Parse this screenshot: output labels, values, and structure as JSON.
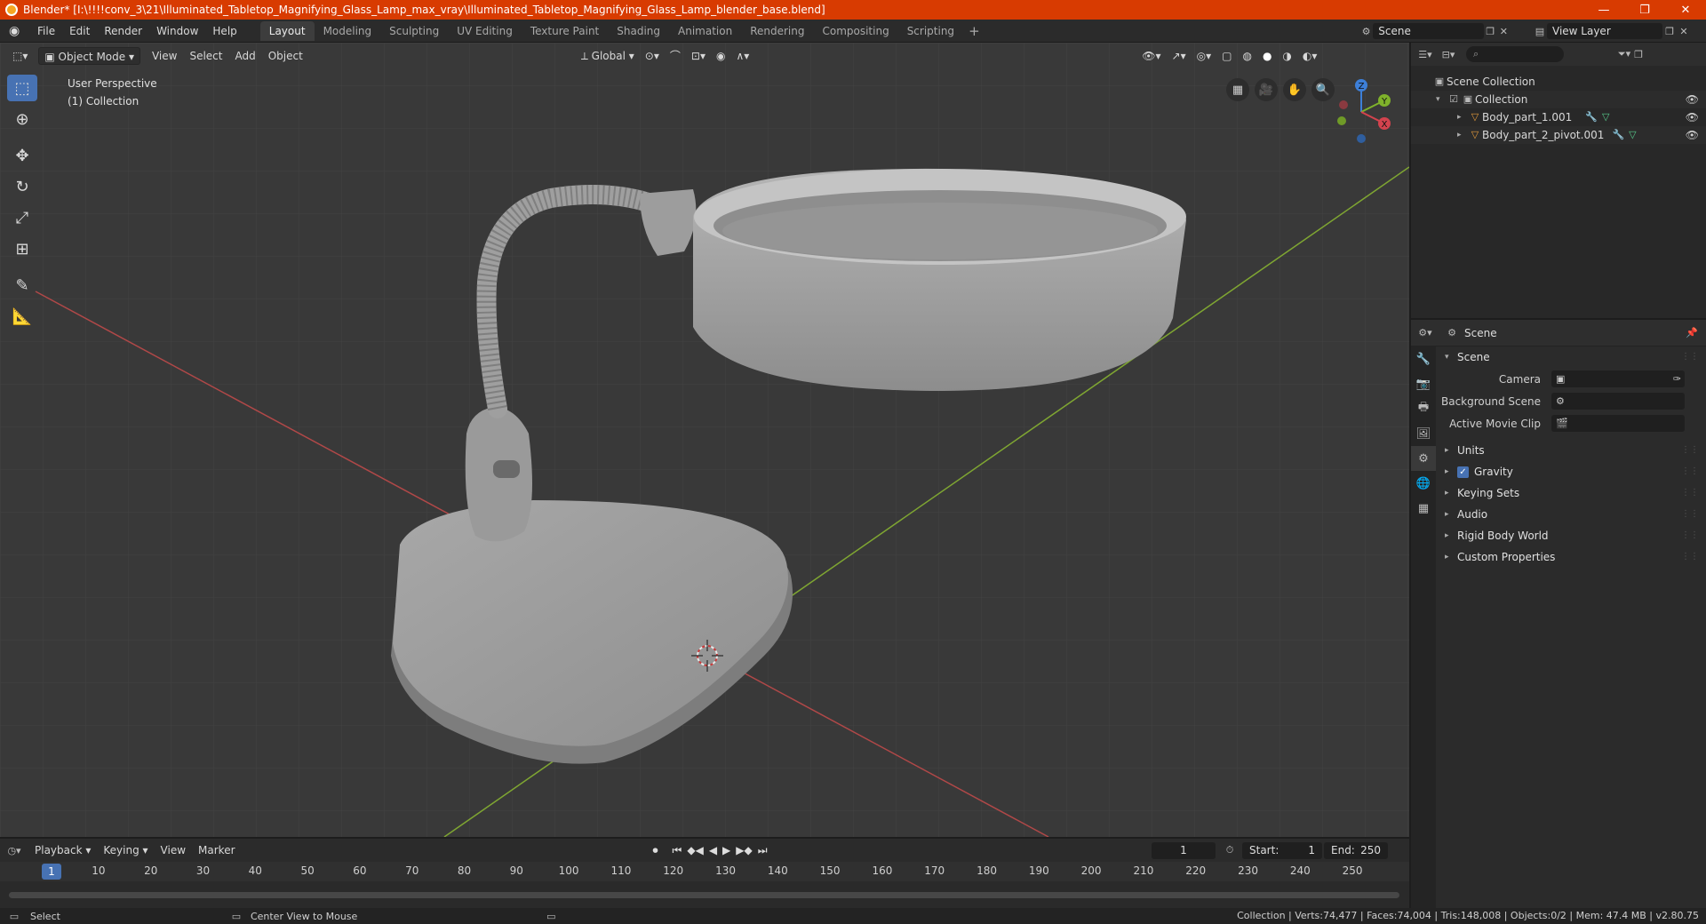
{
  "window": {
    "title": "Blender* [I:\\!!!!conv_3\\21\\Illuminated_Tabletop_Magnifying_Glass_Lamp_max_vray\\Illuminated_Tabletop_Magnifying_Glass_Lamp_blender_base.blend]",
    "controls": {
      "minimize": "—",
      "maximize": "❐",
      "close": "✕"
    }
  },
  "menu": [
    "File",
    "Edit",
    "Render",
    "Window",
    "Help"
  ],
  "workspaces": [
    "Layout",
    "Modeling",
    "Sculpting",
    "UV Editing",
    "Texture Paint",
    "Shading",
    "Animation",
    "Rendering",
    "Compositing",
    "Scripting"
  ],
  "workspace_add": "+",
  "scene_name": "Scene",
  "view_layer": "View Layer",
  "viewport": {
    "mode": "Object Mode",
    "menus": [
      "View",
      "Select",
      "Add",
      "Object"
    ],
    "orientation": "Global",
    "perspective_label": "User Perspective",
    "collection_label": "(1) Collection",
    "gizmo_axes": {
      "z": "Z",
      "y": "Y",
      "x": "X"
    }
  },
  "outliner": {
    "root": "Scene Collection",
    "collection": "Collection",
    "objects": [
      "Body_part_1.001",
      "Body_part_2_pivot.001"
    ]
  },
  "properties": {
    "context": "Scene",
    "panel_title": "Scene",
    "fields": [
      {
        "label": "Camera"
      },
      {
        "label": "Background Scene"
      },
      {
        "label": "Active Movie Clip"
      }
    ],
    "subpanels": [
      "Units",
      "Gravity",
      "Keying Sets",
      "Audio",
      "Rigid Body World",
      "Custom Properties"
    ],
    "gravity_checked": true
  },
  "timeline": {
    "menus": [
      "Playback",
      "Keying",
      "View",
      "Marker"
    ],
    "current_frame": "1",
    "start_label": "Start:",
    "start": "1",
    "end_label": "End:",
    "end": "250",
    "ruler": [
      "1",
      "10",
      "20",
      "30",
      "40",
      "50",
      "60",
      "70",
      "80",
      "90",
      "100",
      "110",
      "120",
      "130",
      "140",
      "150",
      "160",
      "170",
      "180",
      "190",
      "200",
      "210",
      "220",
      "230",
      "240",
      "250"
    ]
  },
  "statusbar": {
    "left_hint": "Select",
    "mid_hint": "Center View to Mouse",
    "stats": "Collection | Verts:74,477 | Faces:74,004 | Tris:148,008 | Objects:0/2 | Mem: 47.4 MB | v2.80.75"
  },
  "colors": {
    "titlebar": "#d83b01",
    "accent": "#4772b3",
    "viewport_bg": "#393939",
    "x_axis": "#c94a4a",
    "y_axis": "#8bb82e"
  }
}
